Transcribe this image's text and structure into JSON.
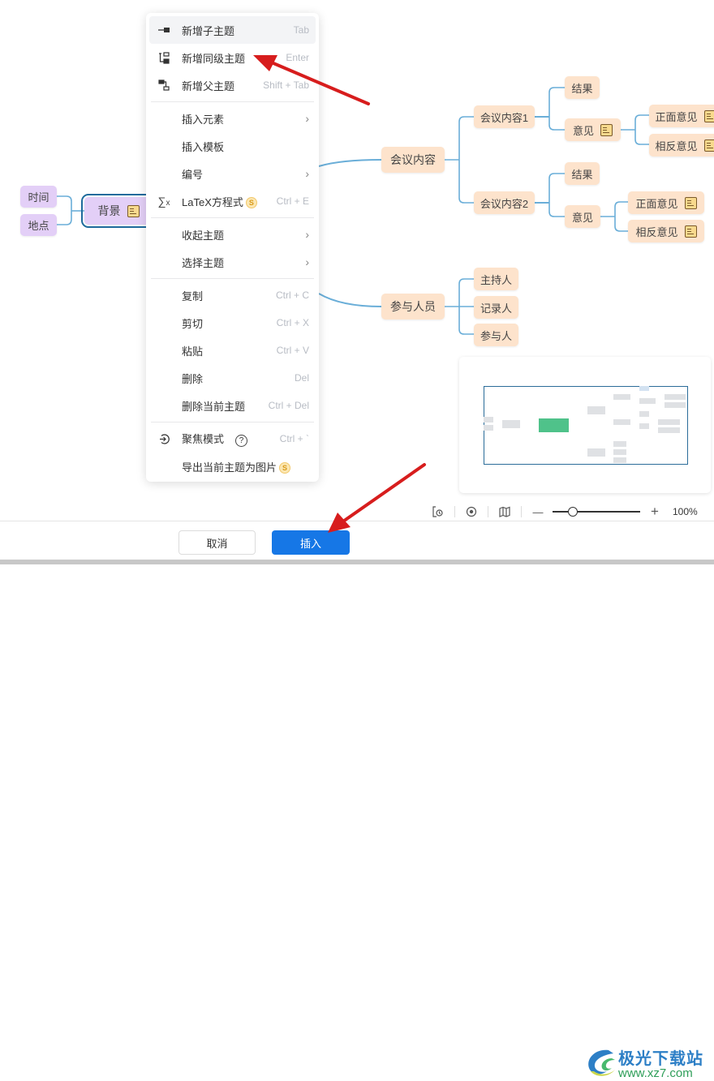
{
  "mindmap": {
    "left_nodes": [
      "时间",
      "地点"
    ],
    "selected_node": "背景",
    "branch1": {
      "label": "会议内容",
      "children": [
        {
          "label": "会议内容1",
          "children": [
            {
              "label": "结果"
            },
            {
              "label": "意见",
              "has_note": true,
              "children": [
                {
                  "label": "正面意见",
                  "has_note": true
                },
                {
                  "label": "相反意见",
                  "has_note": true
                }
              ]
            }
          ]
        },
        {
          "label": "会议内容2",
          "children": [
            {
              "label": "结果"
            },
            {
              "label": "意见",
              "children": [
                {
                  "label": "正面意见",
                  "has_note": true
                },
                {
                  "label": "相反意见",
                  "has_note": true
                }
              ]
            }
          ]
        }
      ]
    },
    "branch2": {
      "label": "参与人员",
      "children": [
        {
          "label": "主持人"
        },
        {
          "label": "记录人"
        },
        {
          "label": "参与人"
        }
      ]
    }
  },
  "context_menu": {
    "groups": [
      [
        {
          "icon": "add-child-icon",
          "label": "新增子主题",
          "shortcut": "Tab",
          "hover": true
        },
        {
          "icon": "add-sibling-icon",
          "label": "新增同级主题",
          "shortcut": "Enter"
        },
        {
          "icon": "add-parent-icon",
          "label": "新增父主题",
          "shortcut": "Shift + Tab"
        }
      ],
      [
        {
          "label": "插入元素",
          "submenu": true
        },
        {
          "label": "插入模板"
        },
        {
          "label": "编号",
          "submenu": true
        },
        {
          "icon": "sigma-icon",
          "label": "LaTeX方程式",
          "vip": true,
          "shortcut": "Ctrl + E"
        }
      ],
      [
        {
          "label": "收起主题",
          "submenu": true
        },
        {
          "label": "选择主题",
          "submenu": true
        }
      ],
      [
        {
          "label": "复制",
          "shortcut": "Ctrl + C"
        },
        {
          "label": "剪切",
          "shortcut": "Ctrl + X"
        },
        {
          "label": "粘贴",
          "shortcut": "Ctrl + V"
        },
        {
          "label": "删除",
          "shortcut": "Del"
        },
        {
          "label": "删除当前主题",
          "shortcut": "Ctrl + Del"
        }
      ],
      [
        {
          "icon": "focus-icon",
          "label": "聚焦模式",
          "help": true,
          "shortcut": "Ctrl + `"
        },
        {
          "label": "导出当前主题为图片",
          "vip": true
        }
      ]
    ],
    "vip_glyph": "S",
    "help_glyph": "?",
    "chevron_glyph": "›"
  },
  "toolbar": {
    "zoom_level": "100%",
    "zoom_fraction": 0.23,
    "minus": "—",
    "plus": "+"
  },
  "footer": {
    "cancel_label": "取消",
    "insert_label": "插入"
  },
  "watermark": {
    "title": "极光下载站",
    "url": "www.xz7.com"
  },
  "colors": {
    "accent": "#1677e6",
    "node_orange": "#fde3cc",
    "node_purple": "#e3cff7",
    "line": "#5aa6d6",
    "annotation_arrow": "#d71d1d",
    "minimap_center": "#4fc28a"
  }
}
